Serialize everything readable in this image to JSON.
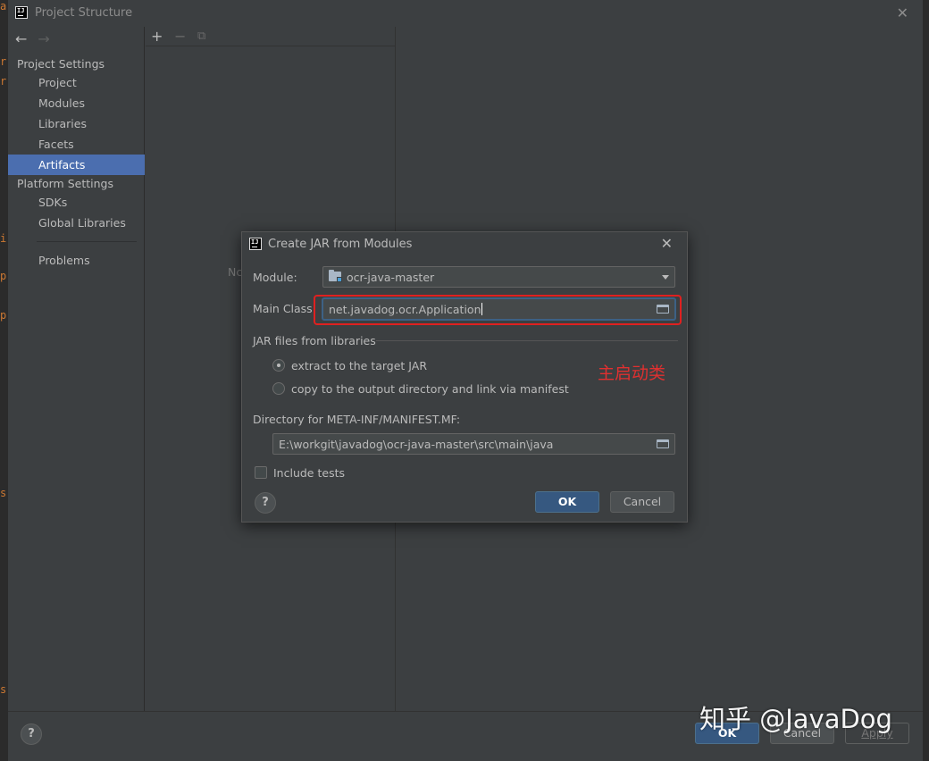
{
  "window": {
    "title": "Project Structure"
  },
  "sidebar": {
    "project_settings_label": "Project Settings",
    "platform_settings_label": "Platform Settings",
    "items": [
      {
        "label": "Project"
      },
      {
        "label": "Modules"
      },
      {
        "label": "Libraries"
      },
      {
        "label": "Facets"
      },
      {
        "label": "Artifacts",
        "selected": true
      },
      {
        "label": "SDKs"
      },
      {
        "label": "Global Libraries"
      },
      {
        "label": "Problems"
      }
    ]
  },
  "middle": {
    "empty_text": "Nc"
  },
  "dialog": {
    "title": "Create JAR from Modules",
    "module_label": "Module:",
    "module_value": "ocr-java-master",
    "main_class_label": "Main Class:",
    "main_class_value": "net.javadog.ocr.Application",
    "jar_files_label": "JAR files from libraries",
    "radio_extract": "extract to the target JAR",
    "radio_copy": "copy to the output directory and link via manifest",
    "manifest_dir_label": "Directory for META-INF/MANIFEST.MF:",
    "manifest_dir_value": "E:\\workgit\\javadog\\ocr-java-master\\src\\main\\java",
    "include_tests_label": "Include tests",
    "ok_label": "OK",
    "cancel_label": "Cancel",
    "help_label": "?",
    "annotation": "主启动类"
  },
  "footer": {
    "help_label": "?",
    "ok_label": "OK",
    "cancel_label": "Cancel",
    "apply_label": "Apply"
  },
  "watermark": "知乎 @JavaDog",
  "colors": {
    "selection": "#4b6eaf",
    "highlight_box": "#e02020",
    "default_button": "#365880"
  }
}
